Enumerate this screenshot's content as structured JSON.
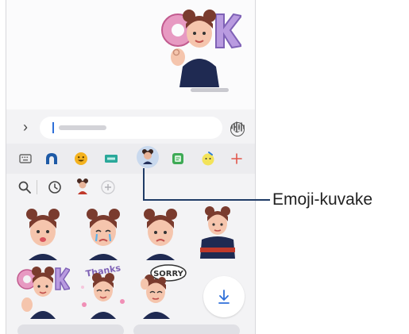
{
  "chat": {
    "sent_sticker_icon": "ok-sticker-icon",
    "sent_time": "blurred"
  },
  "input": {
    "expand_icon": "chevron-right-icon",
    "placeholder": "blurred",
    "emoji_icon": "smiley-icon",
    "voice_icon": "waveform-icon"
  },
  "panel_tabs": [
    {
      "name": "keyboard-icon"
    },
    {
      "name": "bixby-vision-icon"
    },
    {
      "name": "emoji-icon"
    },
    {
      "name": "gif-icon"
    },
    {
      "name": "ar-emoji-icon",
      "selected": true
    },
    {
      "name": "sticker-icon"
    },
    {
      "name": "bitmoji-icon"
    },
    {
      "name": "add-icon"
    }
  ],
  "tools": [
    {
      "name": "search-icon"
    },
    {
      "name": "recent-icon"
    },
    {
      "name": "avatar-icon"
    },
    {
      "name": "add-avatar-icon"
    }
  ],
  "stickers": [
    {
      "name": "sticker-pout"
    },
    {
      "name": "sticker-cry"
    },
    {
      "name": "sticker-sad"
    },
    {
      "name": "sticker-shrug"
    },
    {
      "name": "sticker-ok",
      "text": "OK"
    },
    {
      "name": "sticker-thanks",
      "text": "Thanks"
    },
    {
      "name": "sticker-sorry",
      "text": "SORRY"
    }
  ],
  "download_icon": "download-icon",
  "bottom_buttons": [
    "blurred",
    "blurred"
  ],
  "callout": {
    "label": "Emoji-kuvake"
  },
  "colors": {
    "accent": "#1f3b66",
    "selected_tab": "#c9d9ee",
    "panel_bg": "#ececef"
  }
}
